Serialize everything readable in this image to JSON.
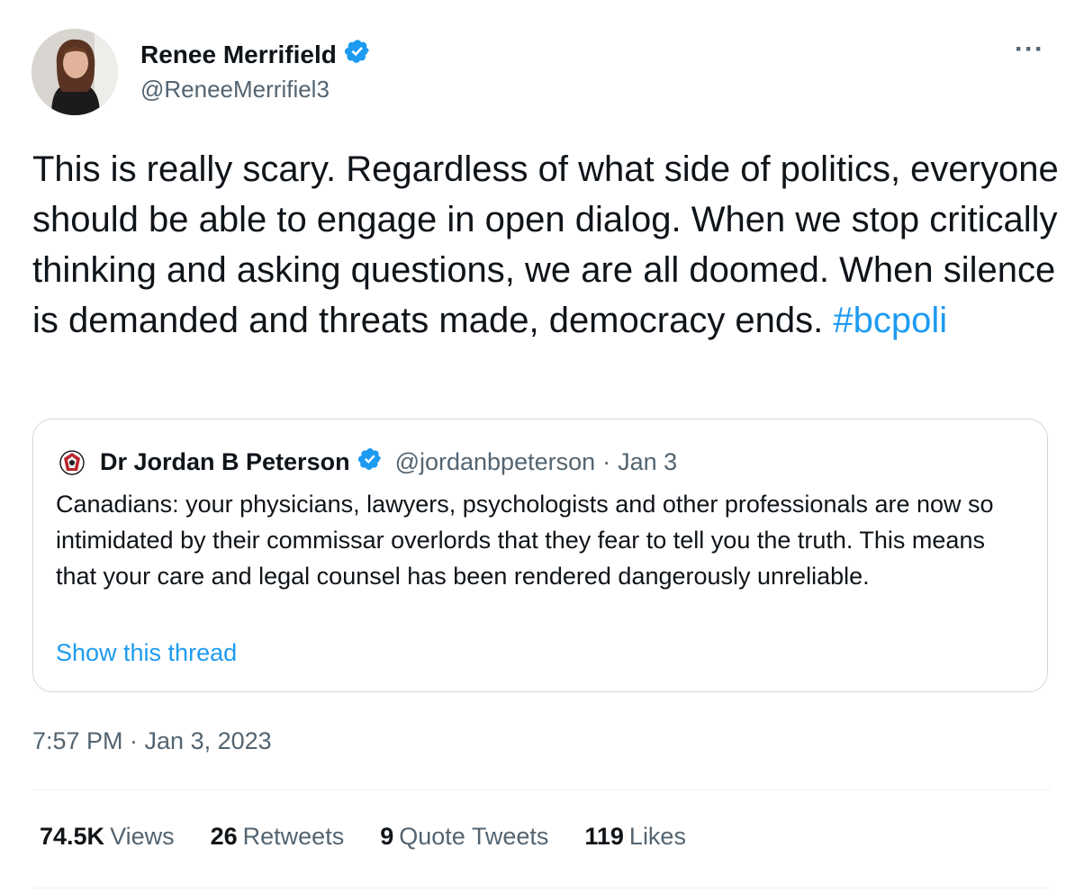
{
  "tweet": {
    "author": {
      "name": "Renee Merrifield",
      "handle": "@ReneeMerrifiel3",
      "verified": true
    },
    "menu_icon": "more-dots-icon",
    "text": "This is really scary. Regardless of what side of politics, everyone should be able to engage in open dialog. When we stop critically thinking and asking questions, we are all doomed. When silence is demanded and threats made, democracy ends.",
    "hashtag": "#bcpoli",
    "quoted": {
      "name": "Dr Jordan B Peterson",
      "handle": "@jordanbpeterson",
      "separator": "·",
      "date": "Jan 3",
      "text": "Canadians: your physicians, lawyers, psychologists and other professionals are now so intimidated by their commissar overlords that they fear to tell you the truth. This means that your care and legal counsel has been rendered dangerously unreliable.",
      "show_thread": "Show this thread"
    },
    "timestamp": "7:57 PM · Jan 3, 2023",
    "stats": {
      "views": {
        "value": "74.5K",
        "label": "Views"
      },
      "retweets": {
        "value": "26",
        "label": "Retweets"
      },
      "quotes": {
        "value": "9",
        "label": "Quote Tweets"
      },
      "likes": {
        "value": "119",
        "label": "Likes"
      }
    }
  },
  "colors": {
    "accent": "#1d9bf0",
    "text": "#0f1419",
    "secondary": "#536471",
    "border": "#cfd9de"
  }
}
